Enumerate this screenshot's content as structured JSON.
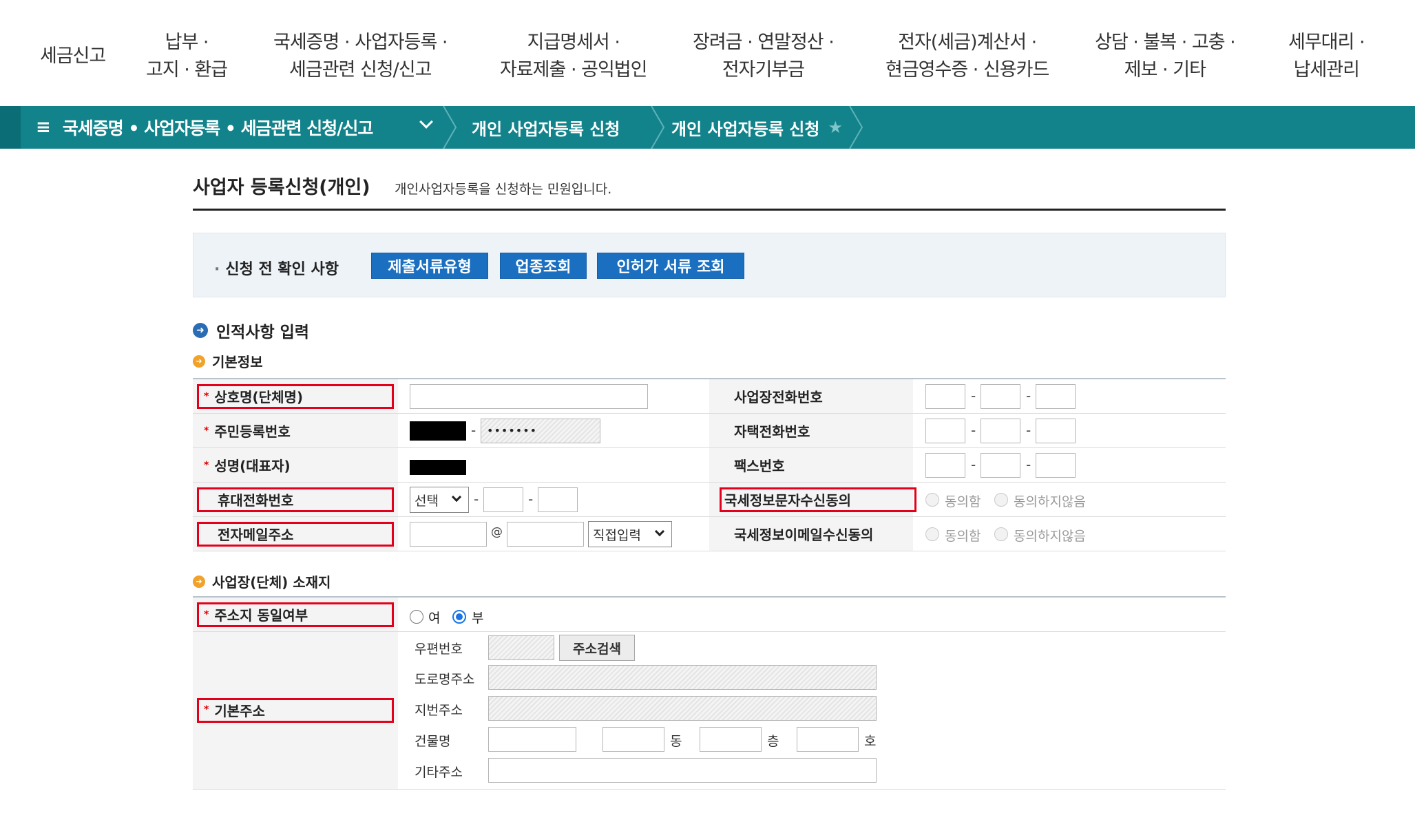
{
  "top_nav": [
    {
      "line1": "세금신고",
      "line2": ""
    },
    {
      "line1": "납부 ·",
      "line2": "고지 · 환급"
    },
    {
      "line1": "국세증명 · 사업자등록 ·",
      "line2": "세금관련 신청/신고"
    },
    {
      "line1": "지급명세서 ·",
      "line2": "자료제출 · 공익법인"
    },
    {
      "line1": "장려금 · 연말정산 ·",
      "line2": "전자기부금"
    },
    {
      "line1": "전자(세금)계산서 ·",
      "line2": "현금영수증 · 신용카드"
    },
    {
      "line1": "상담 · 불복 · 고충 ·",
      "line2": "제보 · 기타"
    },
    {
      "line1": "세무대리 ·",
      "line2": "납세관리"
    }
  ],
  "breadcrumb": {
    "menu_icon": "≡",
    "menu": "국세증명 • 사업자등록 • 세금관련 신청/신고",
    "item1": "개인 사업자등록 신청",
    "item2": "개인 사업자등록 신청",
    "star_icon": "★"
  },
  "page": {
    "title": "사업자 등록신청(개인)",
    "subtitle": "개인사업자등록을 신청하는 민원입니다."
  },
  "precheck": {
    "bullet": "·",
    "label": "신청 전 확인 사항",
    "btn_docs": "제출서류유형",
    "btn_industry": "업종조회",
    "btn_permit": "인허가 서류 조회"
  },
  "section_personal": {
    "icon": "➜",
    "title": "인적사항 입력"
  },
  "section_basic": {
    "icon": "➜",
    "title": "기본정보"
  },
  "required_mark": "*",
  "fields": {
    "trade_name": "상호명(단체명)",
    "resident_no": "주민등록번호",
    "resident_no_back": "•••••••",
    "name": "성명(대표자)",
    "mobile": "휴대전화번호",
    "mobile_select": "선택",
    "email": "전자메일주소",
    "email_at": "@",
    "email_select": "직접입력",
    "biz_phone": "사업장전화번호",
    "home_phone": "자택전화번호",
    "fax": "팩스번호",
    "sms_consent": "국세정보문자수신동의",
    "email_consent": "국세정보이메일수신동의",
    "agree": "동의함",
    "disagree": "동의하지않음",
    "dash": "-"
  },
  "section_location": {
    "icon": "➜",
    "title": "사업장(단체) 소재지"
  },
  "location": {
    "same_address": "주소지 동일여부",
    "yes": "여",
    "no": "부",
    "selected": "부",
    "basic_address": "기본주소",
    "postal_code": "우편번호",
    "search_btn": "주소검색",
    "road_address": "도로명주소",
    "lot_address": "지번주소",
    "building": "건물명",
    "dong": "동",
    "floor": "층",
    "ho": "호",
    "other_address": "기타주소"
  }
}
